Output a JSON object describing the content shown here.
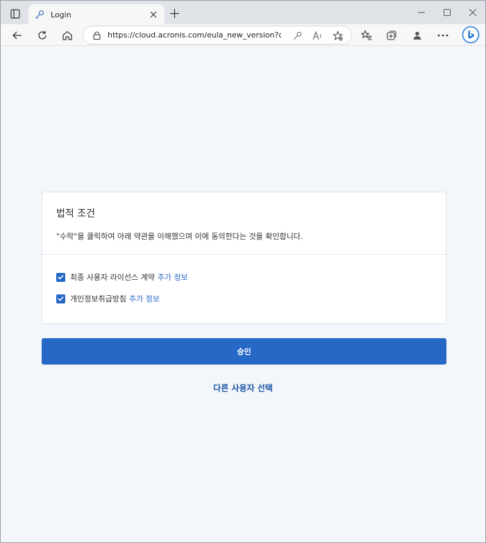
{
  "browser": {
    "tab": {
      "title": "Login",
      "favicon": "key-icon"
    },
    "address": {
      "url": "https://cloud.acronis.com/eula_new_version?cm..."
    }
  },
  "legal": {
    "title": "법적 조건",
    "description": "\"수락\"을 클릭하여 아래 약관을 이해했으며 이에 동의한다는 것을 확인합니다.",
    "items": [
      {
        "label": "최종 사용자 라이선스 계약",
        "link": "추가 정보",
        "checked": true
      },
      {
        "label": "개인정보취급방침",
        "link": "추가 정보",
        "checked": true
      }
    ]
  },
  "actions": {
    "approve_label": "승인",
    "other_user_label": "다른 사용자 선택"
  },
  "colors": {
    "accent": "#2668c5"
  }
}
